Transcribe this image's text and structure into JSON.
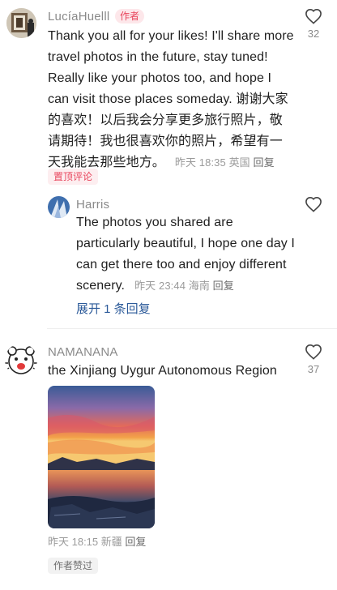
{
  "comments": [
    {
      "username": "LucíaHuelll",
      "badge": "作者",
      "text": "Thank you all for your likes! I'll share more travel photos in the future, stay tuned! Really like your photos too, and hope I can visit those places someday. 谢谢大家的喜欢！以后我会分享更多旅行照片，敬请期待！我也很喜欢你的照片，希望有一天我能去那些地方。",
      "time": "昨天 18:35",
      "location": "英国",
      "reply_label": "回复",
      "likes": "32",
      "pinned_label": "置顶评论",
      "replies": [
        {
          "username": "Harris",
          "text": "The photos you shared are particularly beautiful, I hope one day I can get there too and enjoy different scenery.",
          "time": "昨天 23:44",
          "location": "海南",
          "reply_label": "回复"
        }
      ],
      "expand_label": "展开 1 条回复"
    },
    {
      "username": "NAMANANA",
      "text": "the Xinjiang Uygur Autonomous Region",
      "time": "昨天 18:15",
      "location": "新疆",
      "reply_label": "回复",
      "likes": "37",
      "liked_by_author_label": "作者赞过"
    }
  ],
  "colors": {
    "accent_red": "#e8455c",
    "link_blue": "#2d5b9a",
    "meta_gray": "#9a9a9a"
  },
  "icons": {
    "like": "heart-outline-icon"
  }
}
